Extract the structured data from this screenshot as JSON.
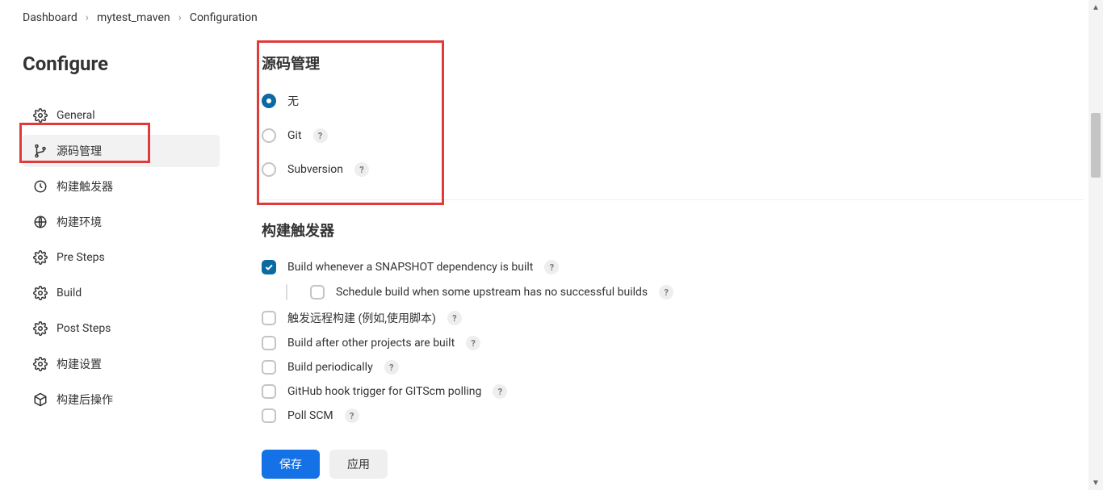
{
  "breadcrumb": {
    "items": [
      "Dashboard",
      "mytest_maven",
      "Configuration"
    ]
  },
  "sidebar": {
    "title": "Configure",
    "items": [
      {
        "label": "General",
        "icon": "gear"
      },
      {
        "label": "源码管理",
        "icon": "branch",
        "active": true
      },
      {
        "label": "构建触发器",
        "icon": "clock"
      },
      {
        "label": "构建环境",
        "icon": "globe"
      },
      {
        "label": "Pre Steps",
        "icon": "gear"
      },
      {
        "label": "Build",
        "icon": "gear"
      },
      {
        "label": "Post Steps",
        "icon": "gear"
      },
      {
        "label": "构建设置",
        "icon": "gear"
      },
      {
        "label": "构建后操作",
        "icon": "package"
      }
    ]
  },
  "scm": {
    "title": "源码管理",
    "options": [
      {
        "label": "无",
        "selected": true,
        "help": false
      },
      {
        "label": "Git",
        "selected": false,
        "help": true
      },
      {
        "label": "Subversion",
        "selected": false,
        "help": true
      }
    ]
  },
  "triggers": {
    "title": "构建触发器",
    "items": [
      {
        "label": "Build whenever a SNAPSHOT dependency is built",
        "checked": true,
        "help": true
      },
      {
        "label": "Schedule build when some upstream has no successful builds",
        "checked": false,
        "help": true,
        "indent": true
      },
      {
        "label": "触发远程构建 (例如,使用脚本)",
        "checked": false,
        "help": true
      },
      {
        "label": "Build after other projects are built",
        "checked": false,
        "help": true
      },
      {
        "label": "Build periodically",
        "checked": false,
        "help": true
      },
      {
        "label": "GitHub hook trigger for GITScm polling",
        "checked": false,
        "help": true
      },
      {
        "label": "Poll SCM",
        "checked": false,
        "help": true
      }
    ]
  },
  "buttons": {
    "save": "保存",
    "apply": "应用"
  },
  "help_glyph": "?"
}
